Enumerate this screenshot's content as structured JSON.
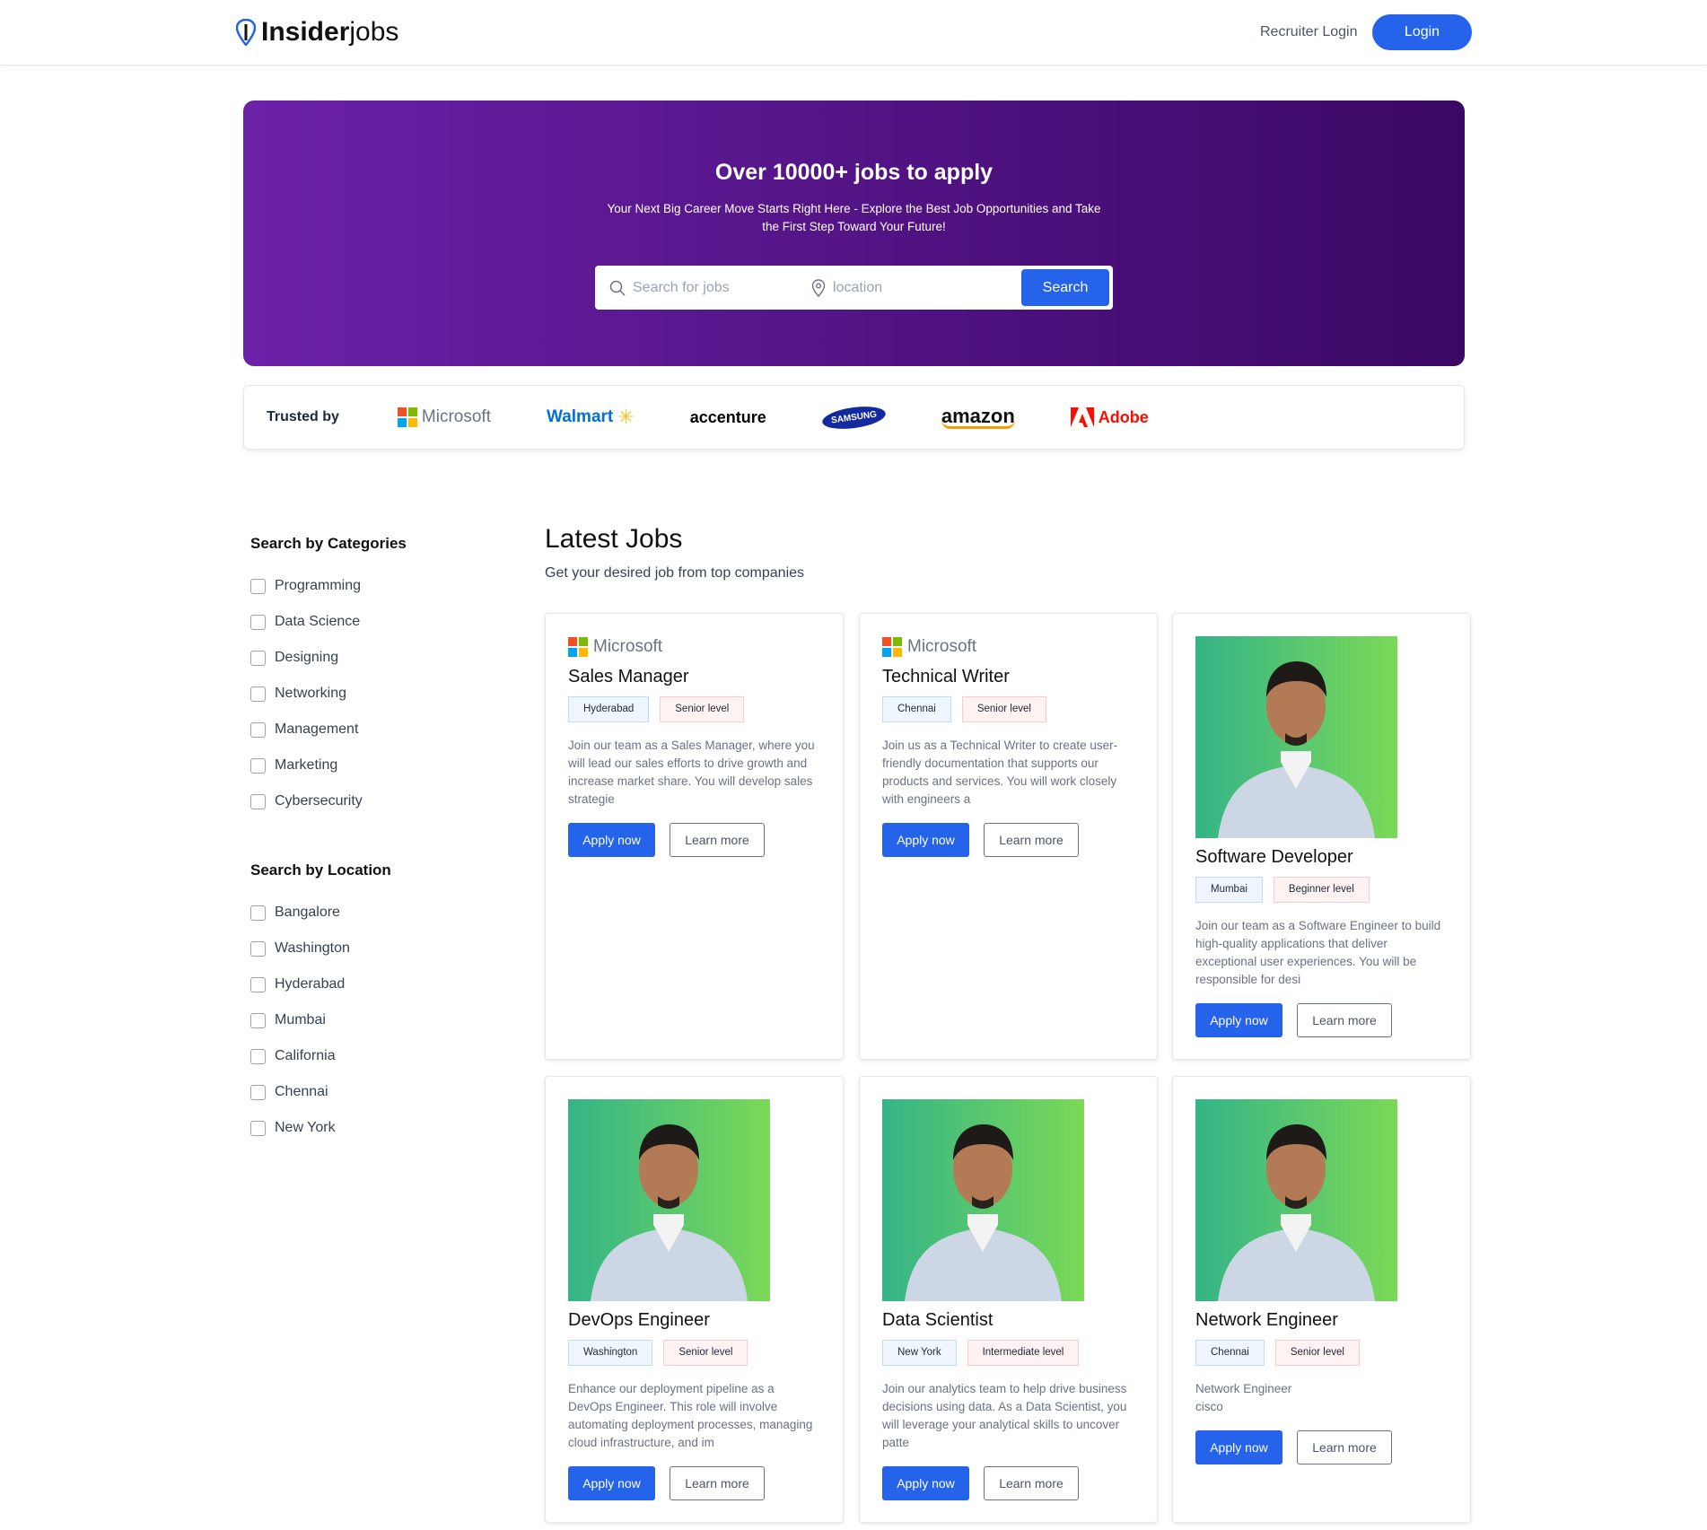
{
  "header": {
    "logo_bold": "Insider",
    "logo_light": "jobs",
    "recruiter_login": "Recruiter Login",
    "login": "Login"
  },
  "hero": {
    "title": "Over 10000+ jobs to apply",
    "subtitle": "Your Next Big Career Move Starts Right Here - Explore the Best Job Opportunities and Take the First Step Toward Your Future!",
    "search_placeholder": "Search for jobs",
    "location_placeholder": "location",
    "search_button": "Search"
  },
  "trusted": {
    "label": "Trusted by",
    "companies": [
      "Microsoft",
      "Walmart",
      "accenture",
      "SAMSUNG",
      "amazon",
      "Adobe"
    ]
  },
  "sidebar": {
    "categories_title": "Search by Categories",
    "categories": [
      "Programming",
      "Data Science",
      "Designing",
      "Networking",
      "Management",
      "Marketing",
      "Cybersecurity"
    ],
    "location_title": "Search by Location",
    "locations": [
      "Bangalore",
      "Washington",
      "Hyderabad",
      "Mumbai",
      "California",
      "Chennai",
      "New York"
    ]
  },
  "main": {
    "title": "Latest Jobs",
    "subtitle": "Get your desired job from top companies"
  },
  "colors": {
    "primary": "#2563eb",
    "hero_start": "#6b21a8",
    "hero_end": "#3b0764"
  },
  "jobs": [
    {
      "logo": "microsoft",
      "company": "Microsoft",
      "title": "Sales Manager",
      "location": "Hyderabad",
      "level": "Senior level",
      "description": "Join our team as a Sales Manager, where you will lead our sales efforts to drive growth and increase market share. You will develop sales strategie",
      "apply": "Apply now",
      "learn": "Learn more"
    },
    {
      "logo": "microsoft",
      "company": "Microsoft",
      "title": "Technical Writer",
      "location": "Chennai",
      "level": "Senior level",
      "description": "Join us as a Technical Writer to create user-friendly documentation that supports our products and services. You will work closely with engineers a",
      "apply": "Apply now",
      "learn": "Learn more"
    },
    {
      "logo": "photo",
      "title": "Software Developer",
      "location": "Mumbai",
      "level": "Beginner level",
      "description": "Join our team as a Software Engineer to build high-quality applications that deliver exceptional user experiences. You will be responsible for desi",
      "apply": "Apply now",
      "learn": "Learn more"
    },
    {
      "logo": "photo",
      "title": "DevOps Engineer",
      "location": "Washington",
      "level": "Senior level",
      "description": "Enhance our deployment pipeline as a DevOps Engineer. This role will involve automating deployment processes, managing cloud infrastructure, and im",
      "apply": "Apply now",
      "learn": "Learn more"
    },
    {
      "logo": "photo",
      "title": "Data Scientist",
      "location": "New York",
      "level": "Intermediate level",
      "description": "Join our analytics team to help drive business decisions using data. As a Data Scientist, you will leverage your analytical skills to uncover patte",
      "apply": "Apply now",
      "learn": "Learn more"
    },
    {
      "logo": "photo",
      "title": "Network Engineer",
      "location": "Chennai",
      "level": "Senior level",
      "description": "Network Engineer\ncisco",
      "apply": "Apply now",
      "learn": "Learn more"
    }
  ]
}
